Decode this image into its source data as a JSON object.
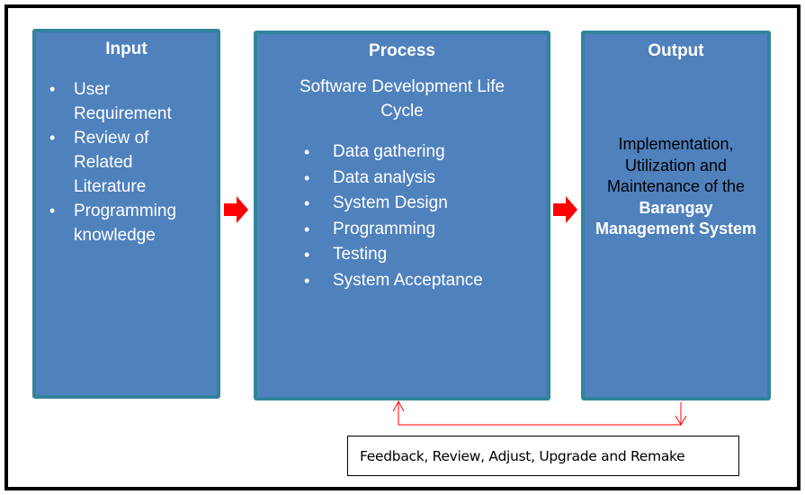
{
  "input": {
    "title": "Input",
    "items": [
      "User Requirement",
      "Review of Related Literature",
      "Programming knowledge"
    ]
  },
  "process": {
    "title": "Process",
    "subtitle": "Software Development Life Cycle",
    "items": [
      "Data gathering",
      "Data analysis",
      "System Design",
      "Programming",
      "Testing",
      "System Acceptance"
    ]
  },
  "output": {
    "title": "Output",
    "text_plain": "Implementation, Utilization and Maintenance of the",
    "text_emphasis": "Barangay Management System"
  },
  "feedback": {
    "label": "Feedback, Review, Adjust, Upgrade and Remake"
  },
  "colors": {
    "box_fill": "#4f81bd",
    "box_border": "#31849b",
    "arrow": "#ff0000",
    "feedback_line": "#ff0000"
  }
}
